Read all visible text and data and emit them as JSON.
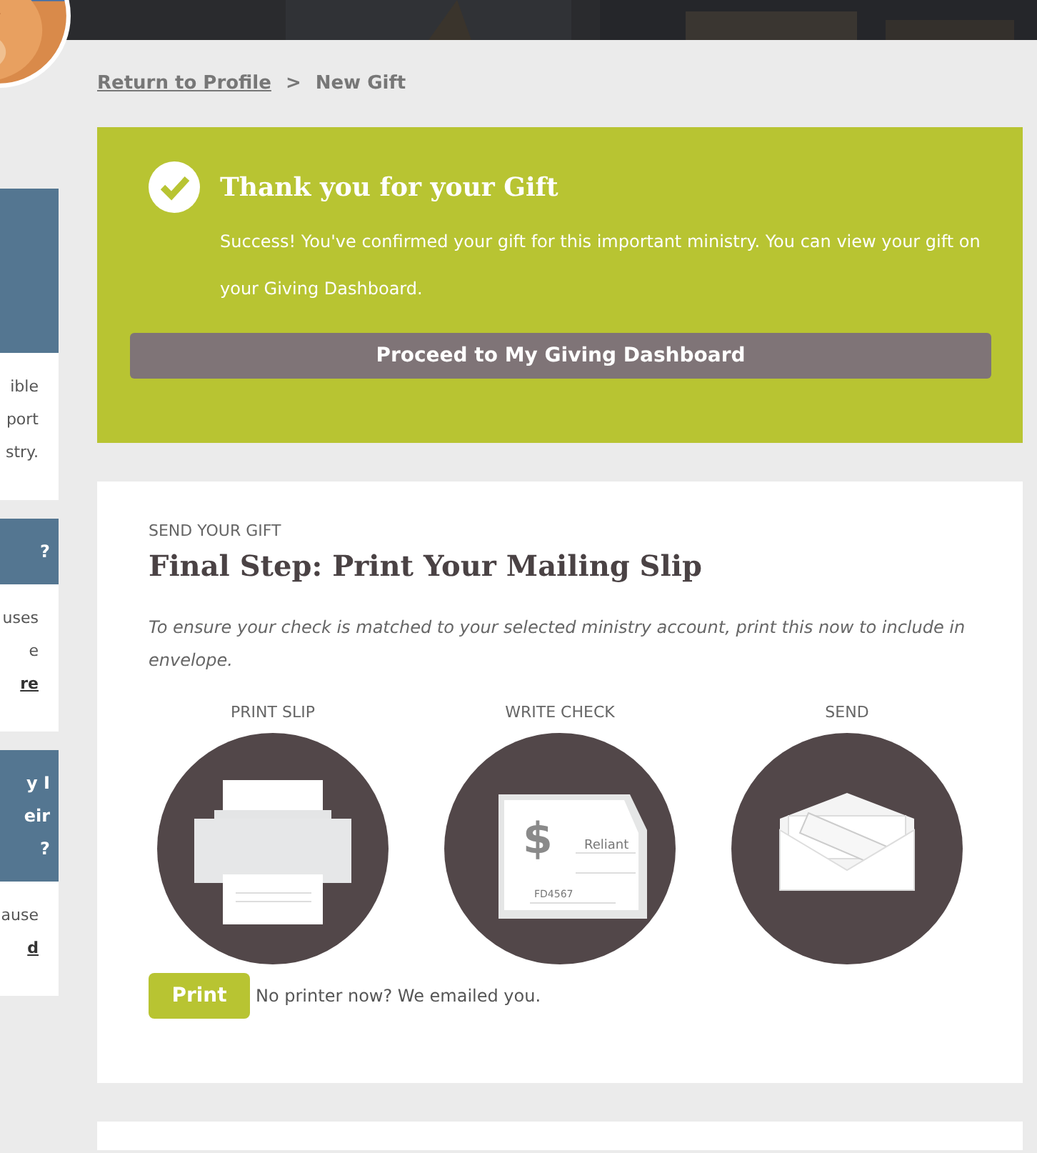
{
  "breadcrumb": {
    "link": "Return to Profile",
    "separator": ">",
    "current": "New Gift"
  },
  "sidebar": {
    "cards": [
      {
        "body_lines": [
          {
            "text": "ible",
            "kind": "text"
          },
          {
            "text": "port",
            "kind": "text"
          },
          {
            "text": "stry.",
            "kind": "text"
          }
        ]
      },
      {
        "header_lines": [
          "?"
        ],
        "body_lines": [
          {
            "text": "uses",
            "kind": "text"
          },
          {
            "text": "e",
            "kind": "text"
          },
          {
            "text": "re",
            "kind": "link"
          }
        ]
      },
      {
        "header_lines": [
          "y I",
          "eir",
          "?"
        ],
        "body_lines": [
          {
            "text": "ause",
            "kind": "text"
          },
          {
            "text": "d",
            "kind": "link"
          }
        ]
      }
    ]
  },
  "success": {
    "title": "Thank you for your Gift",
    "message": "Success! You've confirmed your gift for this important ministry. You can view your gift on your Giving Dashboard.",
    "button": "Proceed to My Giving Dashboard"
  },
  "send": {
    "eyebrow": "SEND YOUR GIFT",
    "heading": "Final Step: Print Your Mailing Slip",
    "instructions": "To ensure your check is matched to your selected ministry account, print this now to include in envelope.",
    "steps": [
      {
        "label": "PRINT SLIP",
        "kind": "printer"
      },
      {
        "label": "WRITE CHECK",
        "kind": "check",
        "check_texts": [
          "$",
          "Reliant",
          "FD4567"
        ]
      },
      {
        "label": "SEND",
        "kind": "envelope"
      }
    ],
    "print_button": "Print",
    "note": "No printer now? We emailed you."
  }
}
